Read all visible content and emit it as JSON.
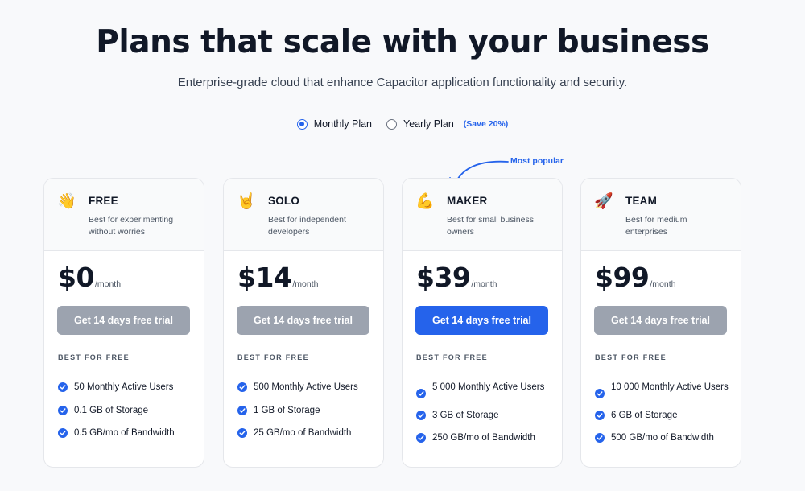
{
  "header": {
    "title": "Plans that scale with your business",
    "subtitle": "Enterprise-grade cloud that enhance Capacitor application functionality and security."
  },
  "billing_toggle": {
    "monthly_label": "Monthly Plan",
    "yearly_label": "Yearly Plan",
    "yearly_badge": "(Save 20%)",
    "selected": "monthly"
  },
  "popular_label": "Most popular",
  "colors": {
    "accent": "#2563eb",
    "button_disabled": "#9ca3af"
  },
  "plans": [
    {
      "emoji": "👋",
      "icon": "waving-hand-icon",
      "name": "FREE",
      "description": "Best for experimenting without worries",
      "price": "$0",
      "period": "/month",
      "cta": "Get 14 days free trial",
      "section_label": "BEST FOR FREE",
      "features": [
        "50 Monthly Active Users",
        "0.1 GB of Storage",
        "0.5 GB/mo of Bandwidth"
      ]
    },
    {
      "emoji": "🤘",
      "icon": "rock-hand-icon",
      "name": "SOLO",
      "description": "Best for independent developers",
      "price": "$14",
      "period": "/month",
      "cta": "Get 14 days free trial",
      "section_label": "BEST FOR FREE",
      "features": [
        "500 Monthly Active Users",
        "1 GB of Storage",
        "25 GB/mo of Bandwidth"
      ]
    },
    {
      "emoji": "💪",
      "icon": "flexed-biceps-icon",
      "name": "MAKER",
      "description": "Best for small business owners",
      "price": "$39",
      "period": "/month",
      "cta": "Get 14 days free trial",
      "section_label": "BEST FOR FREE",
      "features": [
        "5 000 Monthly Active Users",
        "3 GB of Storage",
        "250 GB/mo of Bandwidth"
      ]
    },
    {
      "emoji": "🚀",
      "icon": "rocket-icon",
      "name": "TEAM",
      "description": "Best for medium enterprises",
      "price": "$99",
      "period": "/month",
      "cta": "Get 14 days free trial",
      "section_label": "BEST FOR FREE",
      "features": [
        "10 000 Monthly Active Users",
        "6 GB of Storage",
        "500 GB/mo of Bandwidth"
      ]
    }
  ]
}
